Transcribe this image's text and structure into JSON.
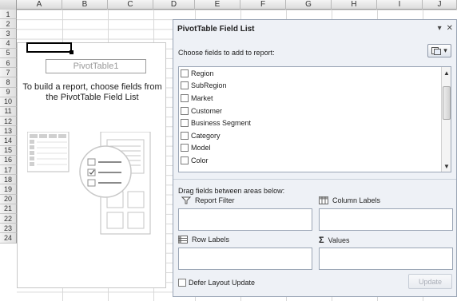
{
  "sheet": {
    "columns": [
      "A",
      "B",
      "C",
      "D",
      "E",
      "F",
      "G",
      "H",
      "I",
      "J"
    ],
    "rows": [
      "1",
      "2",
      "3",
      "4",
      "5",
      "6",
      "7",
      "8",
      "9",
      "10",
      "11",
      "12",
      "13",
      "14",
      "15",
      "16",
      "17",
      "18",
      "19",
      "20",
      "21",
      "22",
      "23",
      "24"
    ]
  },
  "pivot": {
    "name": "PivotTable1",
    "hint": "To build a report, choose fields from the PivotTable Field List"
  },
  "panel": {
    "title": "PivotTable Field List",
    "choose_label": "Choose fields to add to report:",
    "fields": [
      "Region",
      "SubRegion",
      "Market",
      "Customer",
      "Business Segment",
      "Category",
      "Model",
      "Color"
    ],
    "drag_label": "Drag fields between areas below:",
    "areas": {
      "report_filter": "Report Filter",
      "column_labels": "Column Labels",
      "row_labels": "Row Labels",
      "values": "Values"
    },
    "defer_label": "Defer Layout Update",
    "update_label": "Update"
  },
  "icons": {
    "close": "close-icon",
    "dropdown": "chevron-down-icon",
    "filter": "filter-icon",
    "column_labels": "column-labels-icon",
    "row_labels": "row-labels-icon",
    "values": "sigma-icon"
  }
}
